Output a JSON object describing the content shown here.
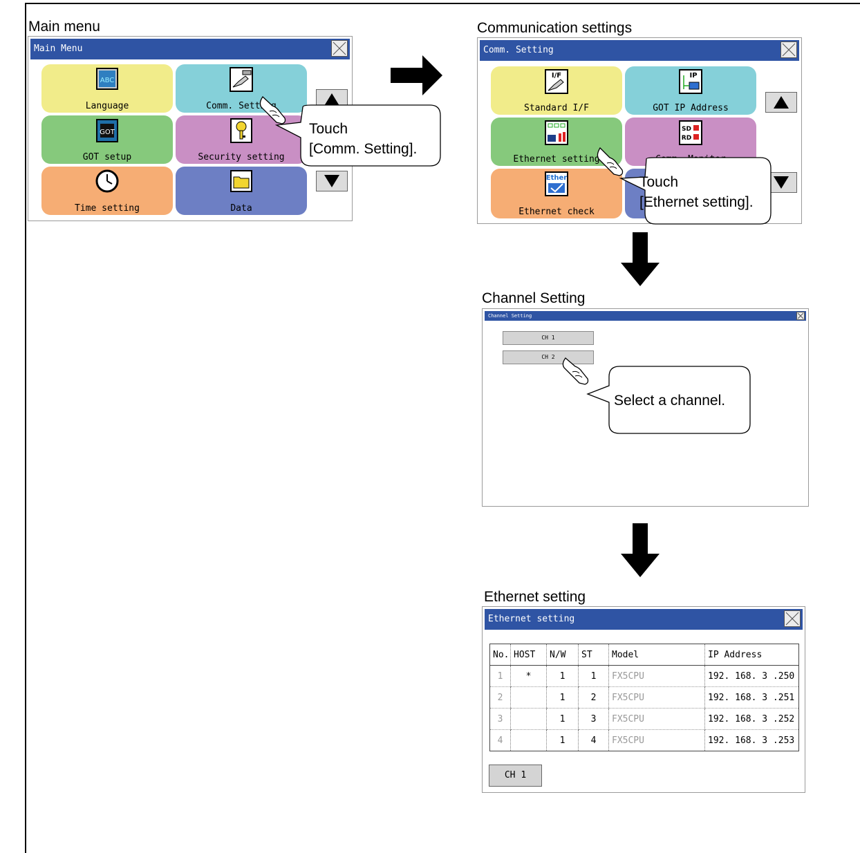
{
  "captions": {
    "main_menu": "Main menu",
    "comm_settings": "Communication settings",
    "channel_setting": "Channel Setting",
    "ethernet_setting": "Ethernet setting"
  },
  "main_menu_screen": {
    "title": "Main Menu",
    "tiles": [
      {
        "label": "Language",
        "icon": "language-icon",
        "color": "#f1ec8a"
      },
      {
        "label": "Comm. Setting",
        "icon": "comm-setting-icon",
        "color": "#85d0d9"
      },
      {
        "label": "GOT setup",
        "icon": "got-setup-icon",
        "color": "#86c97c"
      },
      {
        "label": "Security setting",
        "icon": "key-icon",
        "color": "#c98fc4"
      },
      {
        "label": "Time setting",
        "icon": "clock-icon",
        "color": "#f6ad74"
      },
      {
        "label": "Data",
        "icon": "folder-icon",
        "color": "#6d7fc4"
      }
    ],
    "callout": [
      "Touch",
      "[Comm. Setting]."
    ]
  },
  "comm_screen": {
    "title": "Comm. Setting",
    "tiles": [
      {
        "label": "Standard I/F",
        "icon": "interface-icon",
        "color": "#f1ec8a"
      },
      {
        "label": "GOT IP Address",
        "icon": "ip-address-icon",
        "color": "#85d0d9"
      },
      {
        "label": "Ethernet setting",
        "icon": "ethernet-icon",
        "color": "#86c97c"
      },
      {
        "label": "Comm. Monitor",
        "icon": "comm-monitor-icon",
        "color": "#c98fc4"
      },
      {
        "label": "Ethernet check",
        "icon": "ethernet-check-icon",
        "color": "#f6ad74"
      },
      {
        "label": "",
        "icon": "",
        "color": "#6d7fc4"
      }
    ],
    "callout": [
      "Touch",
      "[Ethernet setting]."
    ]
  },
  "channel_screen": {
    "title": "Channel Setting",
    "buttons": [
      "CH 1",
      "CH 2"
    ],
    "callout": "Select a channel."
  },
  "ethernet_screen": {
    "title": "Ethernet setting",
    "columns": [
      "No.",
      "HOST",
      "N/W",
      "ST",
      "Model",
      "IP Address"
    ],
    "rows": [
      [
        "1",
        "*",
        "1",
        "1",
        "FX5CPU",
        "192. 168.  3 .250"
      ],
      [
        "2",
        "",
        "1",
        "2",
        "FX5CPU",
        "192. 168.  3 .251"
      ],
      [
        "3",
        "",
        "1",
        "3",
        "FX5CPU",
        "192. 168.  3 .252"
      ],
      [
        "4",
        "",
        "1",
        "4",
        "FX5CPU",
        "192. 168.  3 .253"
      ]
    ],
    "channel_button": "CH 1"
  }
}
